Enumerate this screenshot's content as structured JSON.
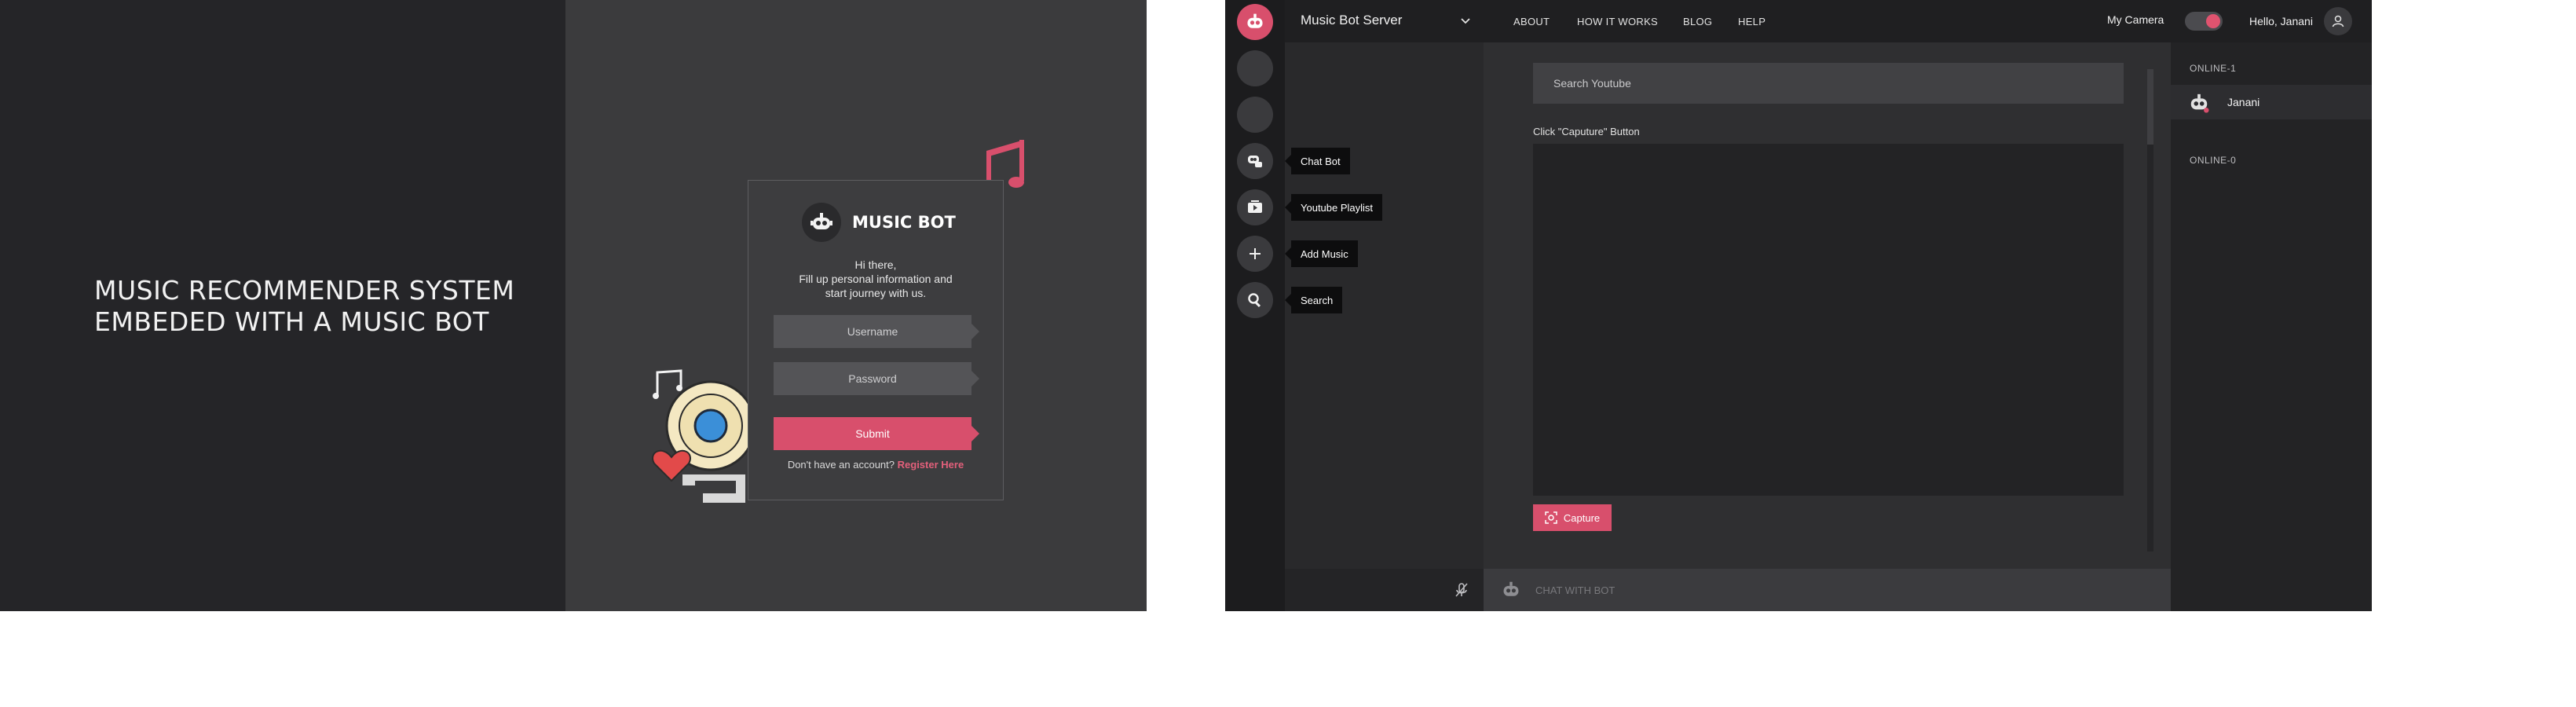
{
  "login": {
    "headline_line1": "MUSIC RECOMMENDER SYSTEM",
    "headline_line2": "EMBEDED WITH A MUSIC BOT",
    "brand": "MUSIC BOT",
    "greeting_line1": "Hi there,",
    "greeting_line2": "Fill up personal information and",
    "greeting_line3": "start journey with us.",
    "username_placeholder": "Username",
    "password_placeholder": "Password",
    "submit_label": "Submit",
    "register_prompt": "Don't have an account?",
    "register_link": "Register Here"
  },
  "app": {
    "server_name": "Music Bot Server",
    "nav": [
      "ABOUT",
      "HOW IT WORKS",
      "BLOG",
      "HELP"
    ],
    "camera_label": "My Camera",
    "camera_on": true,
    "user_greeting": "Hello, Janani",
    "rail_tooltips": {
      "chat_bot": "Chat Bot",
      "youtube_playlist": "Youtube Playlist",
      "add_music": "Add Music",
      "search": "Search"
    },
    "search_placeholder": "Search Youtube",
    "capture_hint": "Click \"Caputure\" Button",
    "capture_label": "Capture",
    "chat_placeholder": "CHAT WITH BOT",
    "members": {
      "online_header": "ONLINE-1",
      "online_user": "Janani",
      "offline_header": "ONLINE-0"
    }
  },
  "colors": {
    "accent": "#d84f6c",
    "dark_bg": "#252528",
    "panel_bg": "#3b3b3d"
  }
}
